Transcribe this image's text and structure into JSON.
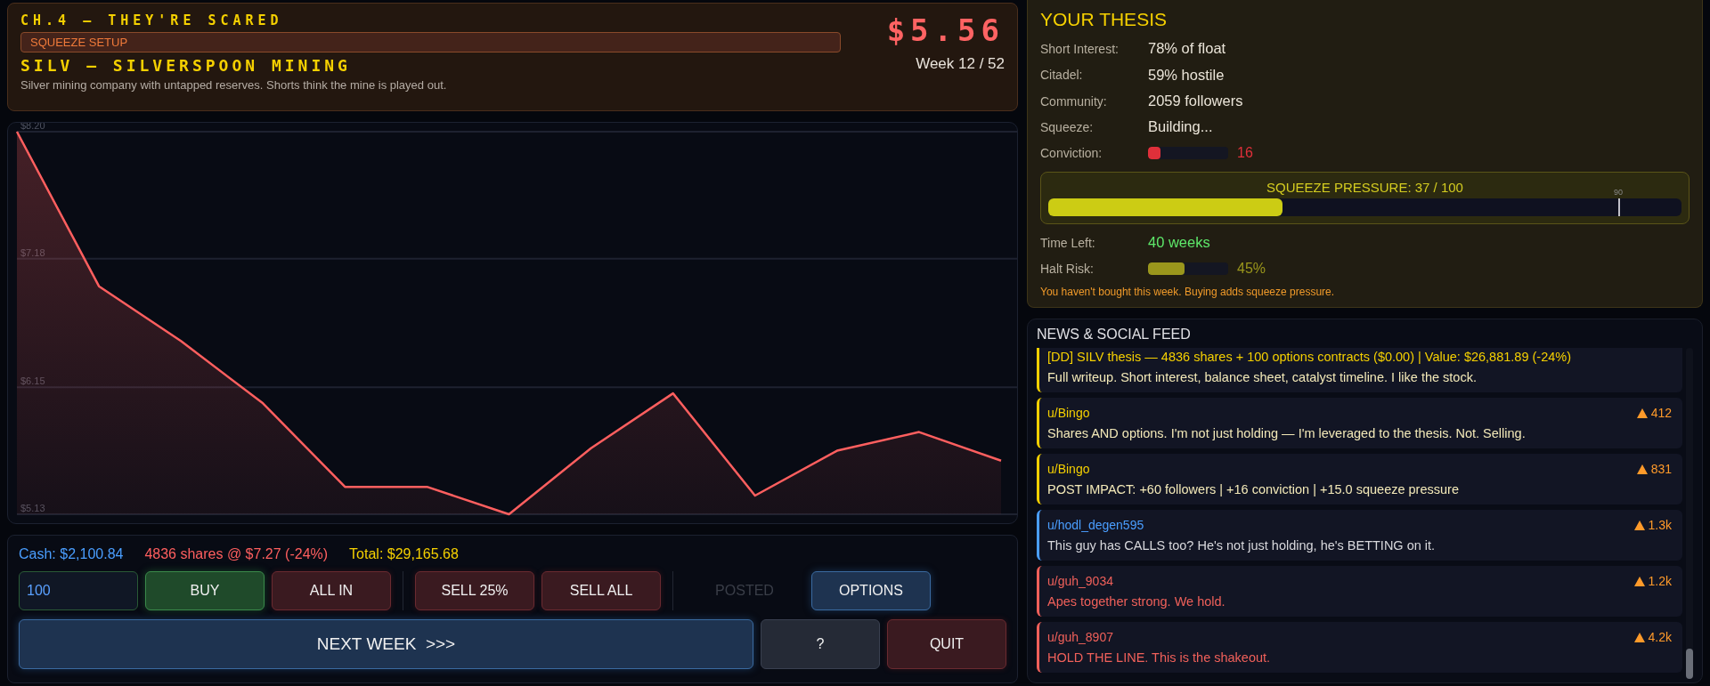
{
  "header": {
    "chapter": "CH.4 — THEY'RE SCARED",
    "tag": "SQUEEZE SETUP",
    "title": "SILV — SILVERSPOON MINING",
    "description": "Silver mining company with untapped reserves. Shorts think the mine is played out.",
    "price": "$5.56",
    "week": "Week 12 / 52"
  },
  "chart": {
    "chart_data": {
      "type": "area",
      "ylim": [
        5.13,
        8.2
      ],
      "yticks": [
        {
          "value": 8.2,
          "label": "$8.20"
        },
        {
          "value": 7.18,
          "label": "$7.18"
        },
        {
          "value": 6.15,
          "label": "$6.15"
        },
        {
          "value": 5.13,
          "label": "$5.13"
        }
      ],
      "series": [
        {
          "color": "#ff5f5f",
          "values": [
            8.2,
            6.96,
            6.52,
            6.02,
            5.35,
            5.35,
            5.13,
            5.66,
            6.1,
            5.28,
            5.64,
            5.79,
            5.56
          ]
        }
      ]
    }
  },
  "portfolio": [
    {
      "text": "Cash: $2,100.84",
      "color": "#4a9eff"
    },
    {
      "text": "4836 shares @ $7.27 (-24%)",
      "color": "#ff5f5f"
    },
    {
      "text": "Total: $29,165.68",
      "color": "#f5d000"
    }
  ],
  "amount_field": {
    "value": "100"
  },
  "trade_groups": [
    [
      {
        "label": "BUY",
        "kind": "buy",
        "disabled": false
      },
      {
        "label": "ALL IN",
        "kind": "danger",
        "disabled": false
      }
    ],
    [
      {
        "label": "SELL 25%",
        "kind": "danger",
        "disabled": false
      },
      {
        "label": "SELL ALL",
        "kind": "danger",
        "disabled": false
      }
    ],
    [
      {
        "label": "POSTED",
        "kind": "plain",
        "disabled": true
      },
      {
        "label": "OPTIONS",
        "kind": "info",
        "disabled": false
      }
    ]
  ],
  "action_buttons": [
    {
      "label": "NEXT WEEK  >>>",
      "kind": "info",
      "wide": true
    },
    {
      "label": "?",
      "kind": "neutral",
      "wide": false
    },
    {
      "label": "QUIT",
      "kind": "danger",
      "wide": false
    }
  ],
  "thesis": {
    "title": "YOUR THESIS",
    "stats": [
      {
        "kind": "text",
        "label": "Short Interest:",
        "value": "78% of float"
      },
      {
        "kind": "text",
        "label": "Citadel:",
        "value": "59% hostile"
      },
      {
        "kind": "text",
        "label": "Community:",
        "value": "2059 followers"
      },
      {
        "kind": "text",
        "label": "Squeeze:",
        "value": "Building..."
      },
      {
        "kind": "meter",
        "label": "Conviction:",
        "level": 0.16,
        "reading": "16",
        "color": "#e0303a"
      }
    ],
    "pressure": {
      "label": "SQUEEZE PRESSURE: 37 / 100",
      "level": 0.37,
      "threshold": {
        "label": "90",
        "level": 0.9
      }
    },
    "stats_after": [
      {
        "kind": "text",
        "label": "Time Left:",
        "value": "40 weeks",
        "color": "#5ee86a"
      },
      {
        "kind": "meter",
        "label": "Halt Risk:",
        "level": 0.45,
        "reading": "45%",
        "color": "#9a961c"
      }
    ],
    "hint": "You haven't bought this week. Buying adds squeeze pressure."
  },
  "feed": {
    "title": "NEWS & SOCIAL FEED",
    "items": [
      {
        "kind": "own",
        "color": "#f5d000",
        "headline": "[DD] SILV thesis — 4836 shares + 100 options contracts ($0.00) | Value: $26,881.89 (-24%)",
        "body": "Full writeup. Short interest, balance sheet, catalyst timeline. I like the stock."
      },
      {
        "kind": "own",
        "color": "#f5d000",
        "author": "u/Bingo",
        "score": "412",
        "body": "Shares AND options. I'm not just holding — I'm leveraged to the thesis. Not. Selling."
      },
      {
        "kind": "own",
        "color": "#f5d000",
        "author": "u/Bingo",
        "score": "831",
        "body": "POST IMPACT: +60 followers | +16 conviction | +15.0 squeeze pressure"
      },
      {
        "kind": "neutral",
        "color": "#4a9eff",
        "author": "u/hodl_degen595",
        "score": "1.3k",
        "body": "This guy has CALLS too? He's not just holding, he's BETTING on it."
      },
      {
        "kind": "hype",
        "color": "#f0605a",
        "author": "u/guh_9034",
        "score": "1.2k",
        "body": "Apes together strong. We hold."
      },
      {
        "kind": "hype",
        "color": "#f0605a",
        "author": "u/guh_8907",
        "score": "4.2k",
        "body": "HOLD THE LINE. This is the shakeout."
      }
    ]
  }
}
